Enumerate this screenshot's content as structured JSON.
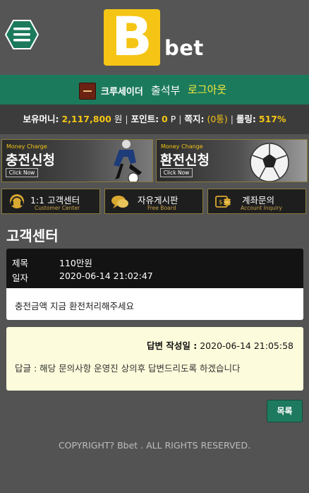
{
  "header": {
    "logo_letter": "B",
    "logo_text": "bet",
    "menu_icon": "hamburger-menu-icon"
  },
  "userbar": {
    "nickname": "크루세이더",
    "attendance_label": "출석부",
    "logout_label": "로그아웃"
  },
  "info": {
    "money_label": "보유머니:",
    "money_value": "2,117,800",
    "money_unit": "원",
    "point_label": "포인트:",
    "point_value": "0",
    "point_unit": "P",
    "message_label": "쪽지:",
    "message_value": "(0통)",
    "rolling_label": "롤링:",
    "rolling_value": "517%"
  },
  "banners": [
    {
      "sub": "Money Charge",
      "title": "충전신청",
      "click": "Click Now"
    },
    {
      "sub": "Money Change",
      "title": "환전신청",
      "click": "Click Now"
    }
  ],
  "nav": [
    {
      "label": "1:1 고객센터",
      "sub": "Customer Center",
      "icon": "headset-icon"
    },
    {
      "label": "자유게시판",
      "sub": "Free Board",
      "icon": "chat-bubble-icon"
    },
    {
      "label": "계좌문의",
      "sub": "Account Inquiry",
      "icon": "coins-icon"
    }
  ],
  "page_title": "고객센터",
  "post": {
    "subject_label": "제목",
    "subject_value": "110만원",
    "date_label": "일자",
    "date_value": "2020-06-14 21:02:47",
    "content": "충전금액 지금 환전처리해주세요"
  },
  "answer": {
    "date_label": "답변 작성일 :",
    "date_value": "2020-06-14 21:05:58",
    "text": "답글 : 해당 문의사항 운영진 상의후 답변드리도록 하겠습니다"
  },
  "list_button": "목록",
  "copyright": "COPYRIGHT? Bbet . ALL RIGHTS RESERVED.",
  "colors": {
    "brand_yellow": "#f5c515",
    "brand_green": "#1c7a5c",
    "logout_yellow": "#f6e93c"
  }
}
